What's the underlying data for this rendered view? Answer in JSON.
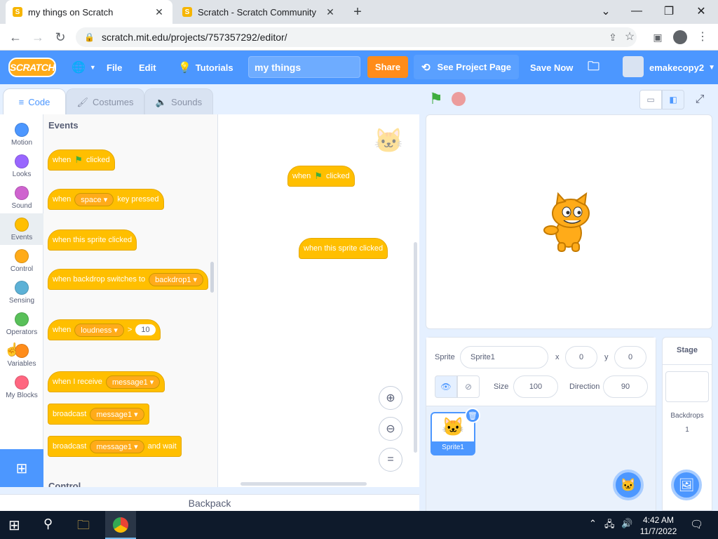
{
  "browser": {
    "tabs": [
      {
        "title": "my things on Scratch",
        "active": true
      },
      {
        "title": "Scratch - Scratch Community Gu",
        "active": false
      }
    ],
    "url": "scratch.mit.edu/projects/757357292/editor/"
  },
  "menu": {
    "logo": "SCRATCH",
    "file": "File",
    "edit": "Edit",
    "tutorials": "Tutorials",
    "project_title": "my things",
    "share": "Share",
    "see_project_page": "See Project Page",
    "save_now": "Save Now",
    "username": "emakecopy2"
  },
  "editor_tabs": {
    "code": "Code",
    "costumes": "Costumes",
    "sounds": "Sounds"
  },
  "categories": [
    {
      "label": "Motion",
      "color": "#4c97ff"
    },
    {
      "label": "Looks",
      "color": "#9966ff"
    },
    {
      "label": "Sound",
      "color": "#cf63cf"
    },
    {
      "label": "Events",
      "color": "#ffbf00"
    },
    {
      "label": "Control",
      "color": "#ffab19"
    },
    {
      "label": "Sensing",
      "color": "#5cb1d6"
    },
    {
      "label": "Operators",
      "color": "#59c059"
    },
    {
      "label": "Variables",
      "color": "#ff8c1a"
    },
    {
      "label": "My Blocks",
      "color": "#ff6680"
    }
  ],
  "palette": {
    "heading": "Events",
    "next_heading": "Control",
    "blocks": {
      "when_flag_1": "when",
      "when_flag_2": "clicked",
      "key_1": "when",
      "key_value": "space",
      "key_2": "key pressed",
      "sprite_clicked": "when this sprite clicked",
      "backdrop_1": "when backdrop switches to",
      "backdrop_value": "backdrop1",
      "loud_1": "when",
      "loud_value": "loudness",
      "loud_op": ">",
      "loud_num": "10",
      "receive_1": "when I receive",
      "receive_value": "message1",
      "broadcast_1": "broadcast",
      "broadcast_value": "message1",
      "broadcastwait_1": "broadcast",
      "broadcastwait_value": "message1",
      "broadcastwait_2": "and wait"
    }
  },
  "script_area": {
    "block1_a": "when",
    "block1_b": "clicked",
    "block2": "when this sprite clicked"
  },
  "backpack": "Backpack",
  "sprite_info": {
    "sprite_label": "Sprite",
    "sprite_name": "Sprite1",
    "x_label": "x",
    "x": "0",
    "y_label": "y",
    "y": "0",
    "size_label": "Size",
    "size": "100",
    "direction_label": "Direction",
    "direction": "90",
    "thumb_name": "Sprite1"
  },
  "stage_panel": {
    "title": "Stage",
    "backdrops_label": "Backdrops",
    "backdrops_count": "1"
  },
  "taskbar": {
    "time": "4:42 AM",
    "date": "11/7/2022"
  }
}
